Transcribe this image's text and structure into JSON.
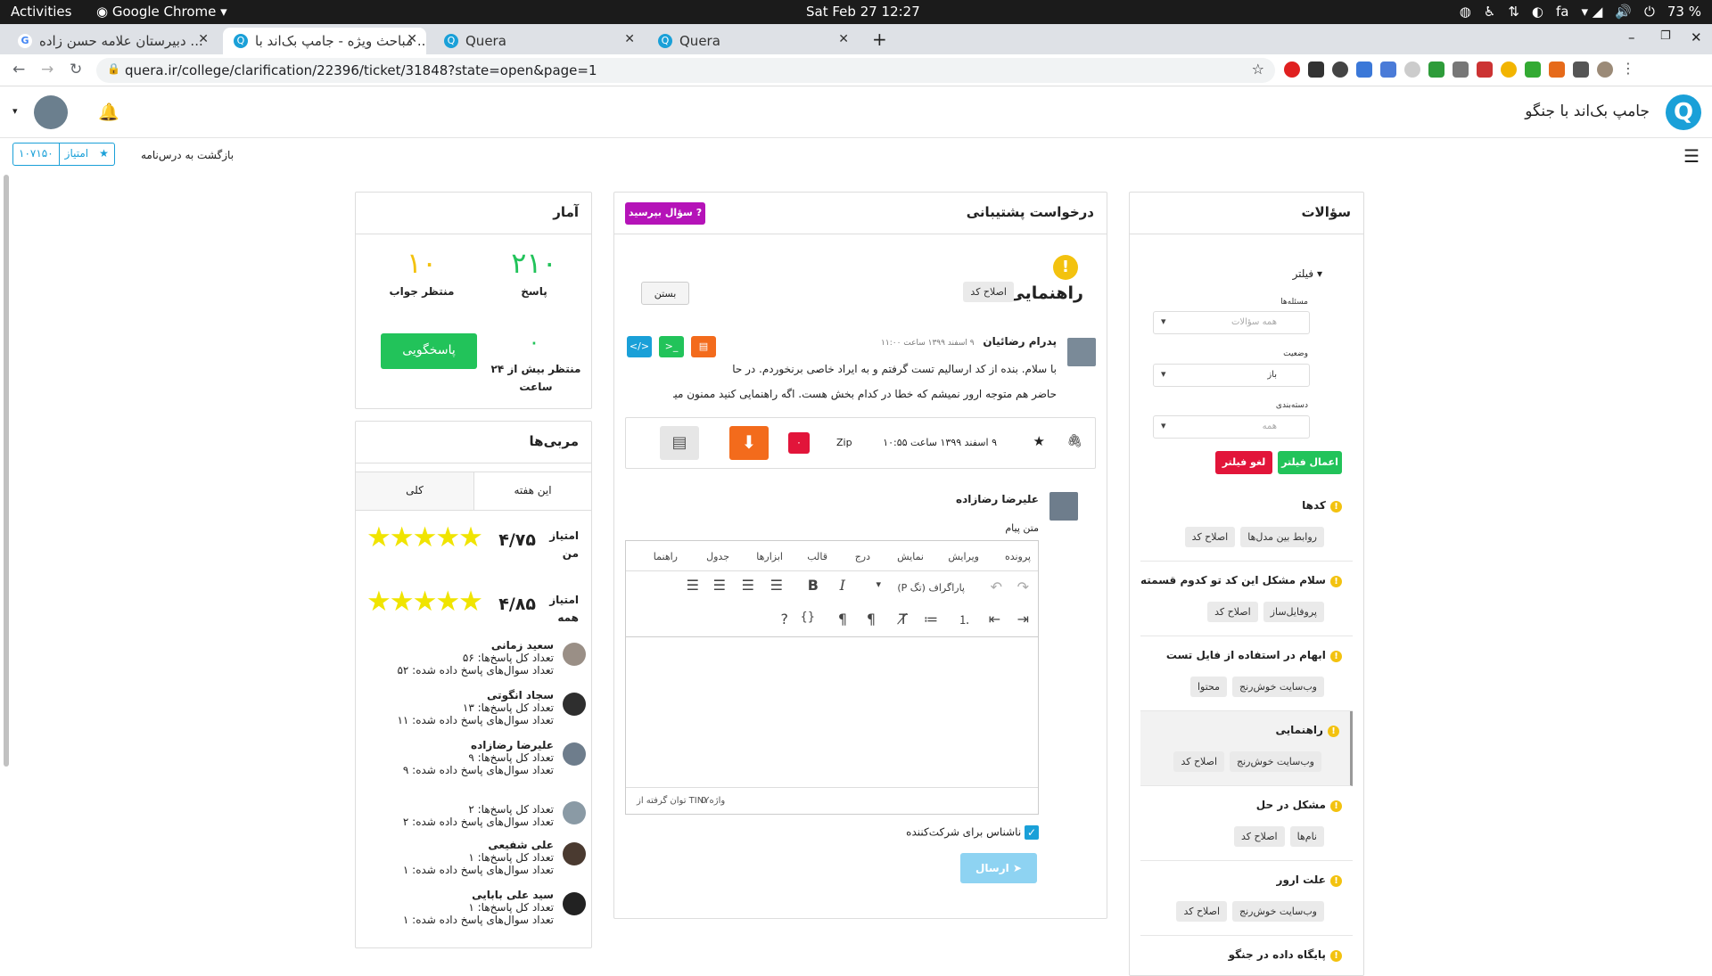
{
  "system": {
    "activities": "Activities",
    "app": "Google Chrome",
    "clock": "Sat Feb 27  12:27",
    "lang": "fa",
    "battery": "73 %"
  },
  "tabs": [
    {
      "title": "دبیرستان علامه حسن زاده ...",
      "icon": "google-icon",
      "color": "#4285f4"
    },
    {
      "title": "مباحث ویژه - جامپ بک‌اند با ...",
      "icon": "quera-icon",
      "color": "#1aa0d8"
    },
    {
      "title": "Quera",
      "icon": "quera-icon",
      "color": "#1aa0d8"
    },
    {
      "title": "Quera",
      "icon": "quera-icon",
      "color": "#1aa0d8"
    }
  ],
  "url": "quera.ir/college/clarification/22396/ticket/31848?state=open&page=1",
  "site": {
    "title": "جامپ بک‌اند با جنگو",
    "logo": "Q",
    "points_label": "امتیاز",
    "points_value": "۱۰۷۱۵۰",
    "back_link": "بازگشت به درس‌نامه"
  },
  "questions": {
    "title": "سؤالات",
    "filter": "فیلتر",
    "problems_label": "مسئله‌ها",
    "problems_value": "همه سؤالات",
    "status_label": "وضعیت",
    "status_value": "باز",
    "category_label": "دسته‌بندی",
    "category_value": "همه",
    "apply": "اعمال فیلتر",
    "cancel": "لغو فیلتر",
    "items": [
      {
        "title": "کدها",
        "tags": [
          "روابط بین مدل‌ها",
          "اصلاح کد"
        ]
      },
      {
        "title": "سلام مشکل این کد تو کدوم قسمته",
        "tags": [
          "پروفایل‌ساز",
          "اصلاح کد"
        ]
      },
      {
        "title": "ابهام در استفاده از فایل تست",
        "tags": [
          "وب‌سایت خوش‌رنج",
          "محتوا"
        ]
      },
      {
        "title": "راهنمایی",
        "tags": [
          "وب‌سایت خوش‌رنج",
          "اصلاح کد"
        ]
      },
      {
        "title": "مشکل در حل",
        "tags": [
          "نام‌ها",
          "اصلاح کد"
        ]
      },
      {
        "title": "علت ارور",
        "tags": [
          "وب‌سایت خوش‌رنج",
          "اصلاح کد"
        ]
      },
      {
        "title": "پایگاه داده در جنگو",
        "tags": []
      }
    ]
  },
  "ticket": {
    "header": "درخواست پشتیبانی",
    "ask_button": "سؤال بپرسید",
    "title": "راهنمایی",
    "tag": "اصلاح کد",
    "close": "بستن",
    "author": "پدرام رضائیان",
    "date": "۹ اسفند ۱۳۹۹ ساعت ۱۱:۰۰",
    "body1": "با سلام. بنده از کد ارسالیم تست گرفتم و به ایراد خاصی برنخوردم. در حا",
    "body2": "حاضر هم متوجه ارور نمیشم که خطا در کدام بخش هست. اگه راهنمایی کنید ممنون میشم.",
    "attach_date": "۹ اسفند ۱۳۹۹ ساعت ۱۰:۵۵",
    "attach_type": "Zip",
    "attach_badge": "۰",
    "reply_author": "علیرضا رضازاده",
    "reply_label": "متن پیام",
    "menu": [
      "پرونده",
      "ویرایش",
      "نمایش",
      "درج",
      "قالب",
      "ابزارها",
      "جدول",
      "راهنما"
    ],
    "paragraph": "پاراگراف (تگ P)",
    "word_count": "0 واژه",
    "powered": "توان گرفته از TINY",
    "anon": "ناشناس برای شرکت‌کننده",
    "send": "ارسال"
  },
  "stats": {
    "title": "آمار",
    "answers_value": "۲۱۰",
    "answers_label": "پاسخ",
    "waiting_value": "۱۰",
    "waiting_label": "منتظر جواب",
    "over24_value": "۰",
    "over24_label": "منتظر بیش از ۲۴ ساعت",
    "respond": "پاسخگویی"
  },
  "coaches": {
    "title": "مربی‌ها",
    "tab_week": "این هفته",
    "tab_all": "کلی",
    "my_score_label": "امتیاز من",
    "my_score": "۴/۷۵",
    "all_score_label": "امتیاز همه",
    "all_score": "۴/۸۵",
    "list": [
      {
        "name": "سعید زمانی",
        "total": "تعداد کل پاسخ‌ها: ۵۶",
        "answered": "تعداد سوال‌های پاسخ داده شده: ۵۲"
      },
      {
        "name": "سجاد انگوتی",
        "total": "تعداد کل پاسخ‌ها: ۱۳",
        "answered": "تعداد سوال‌های پاسخ داده شده: ۱۱"
      },
      {
        "name": "علیرضا رضازاده",
        "total": "تعداد کل پاسخ‌ها: ۹",
        "answered": "تعداد سوال‌های پاسخ داده شده: ۹"
      },
      {
        "name": "",
        "total": "تعداد کل پاسخ‌ها: ۲",
        "answered": "تعداد سوال‌های پاسخ داده شده: ۲"
      },
      {
        "name": "علی شفیعی",
        "total": "تعداد کل پاسخ‌ها: ۱",
        "answered": "تعداد سوال‌های پاسخ داده شده: ۱"
      },
      {
        "name": "سید علی بابایی",
        "total": "تعداد کل پاسخ‌ها: ۱",
        "answered": "تعداد سوال‌های پاسخ داده شده: ۱"
      }
    ]
  }
}
